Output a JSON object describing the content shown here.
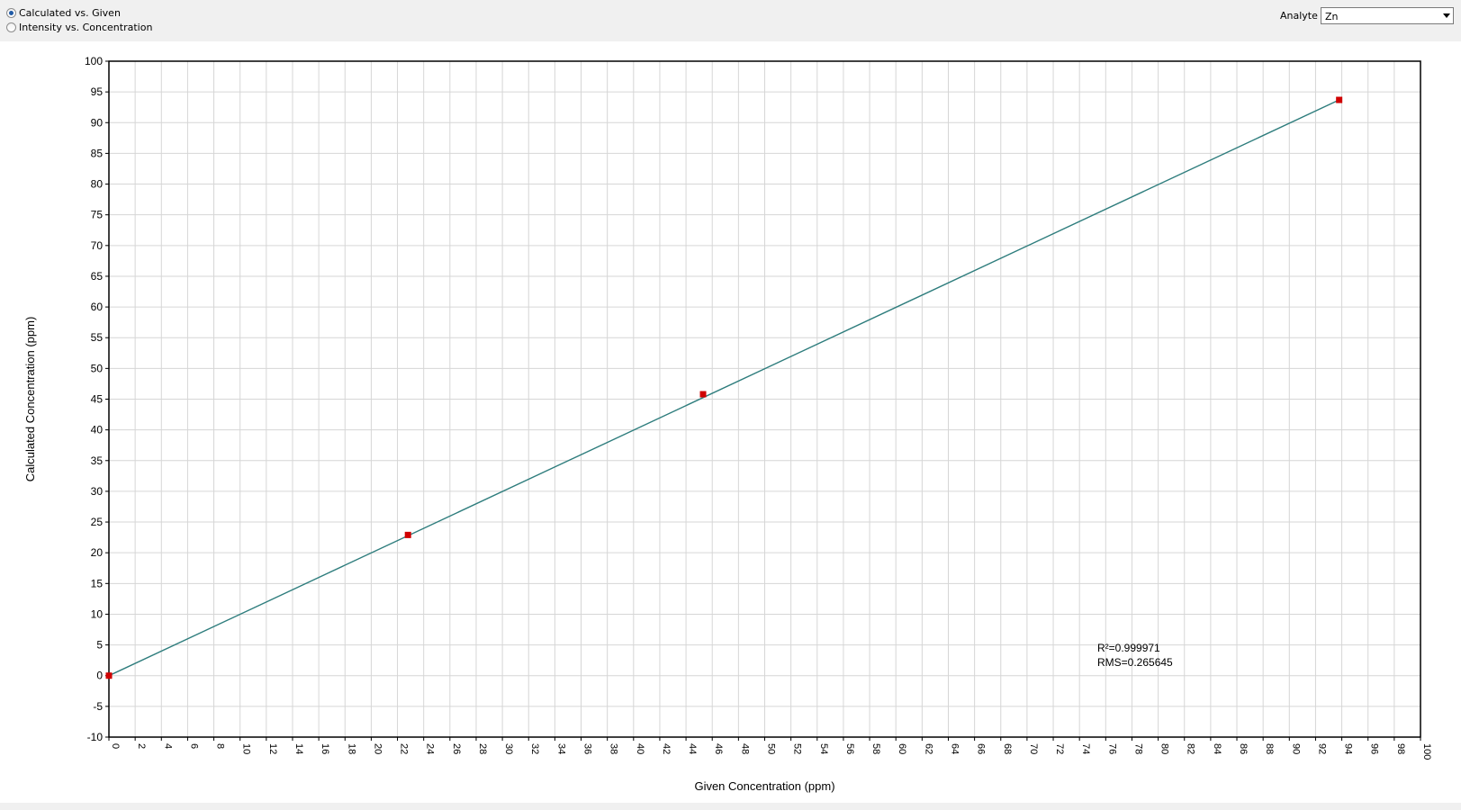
{
  "controls": {
    "radio_calc": "Calculated vs. Given",
    "radio_intensity": "Intensity vs. Concentration",
    "analyte_label": "Analyte",
    "analyte_value": "Zn"
  },
  "chart_data": {
    "type": "scatter",
    "xlabel": "Given Concentration (ppm)",
    "ylabel": "Calculated Concentration (ppm)",
    "xlim": [
      0,
      100
    ],
    "ylim": [
      -10,
      100
    ],
    "xticks": [
      0,
      2,
      4,
      6,
      8,
      10,
      12,
      14,
      16,
      18,
      20,
      22,
      24,
      26,
      28,
      30,
      32,
      34,
      36,
      38,
      40,
      42,
      44,
      46,
      48,
      50,
      52,
      54,
      56,
      58,
      60,
      62,
      64,
      66,
      68,
      70,
      72,
      74,
      76,
      78,
      80,
      82,
      84,
      86,
      88,
      90,
      92,
      94,
      96,
      98,
      100
    ],
    "yticks": [
      -10,
      -5,
      0,
      5,
      10,
      15,
      20,
      25,
      30,
      35,
      40,
      45,
      50,
      55,
      60,
      65,
      70,
      75,
      80,
      85,
      90,
      95,
      100
    ],
    "grid": true,
    "points": [
      {
        "x": 0,
        "y": 0
      },
      {
        "x": 22.8,
        "y": 22.9
      },
      {
        "x": 45.3,
        "y": 45.8
      },
      {
        "x": 93.8,
        "y": 93.7
      }
    ],
    "fit_line": {
      "x": [
        0,
        93.8
      ],
      "y": [
        0,
        93.7
      ]
    },
    "annotation": [
      "R²=0.999971",
      "RMS=0.265645"
    ],
    "colors": {
      "points": "#d00000",
      "line": "#2e7d7d",
      "grid": "#d6d6d6"
    }
  }
}
